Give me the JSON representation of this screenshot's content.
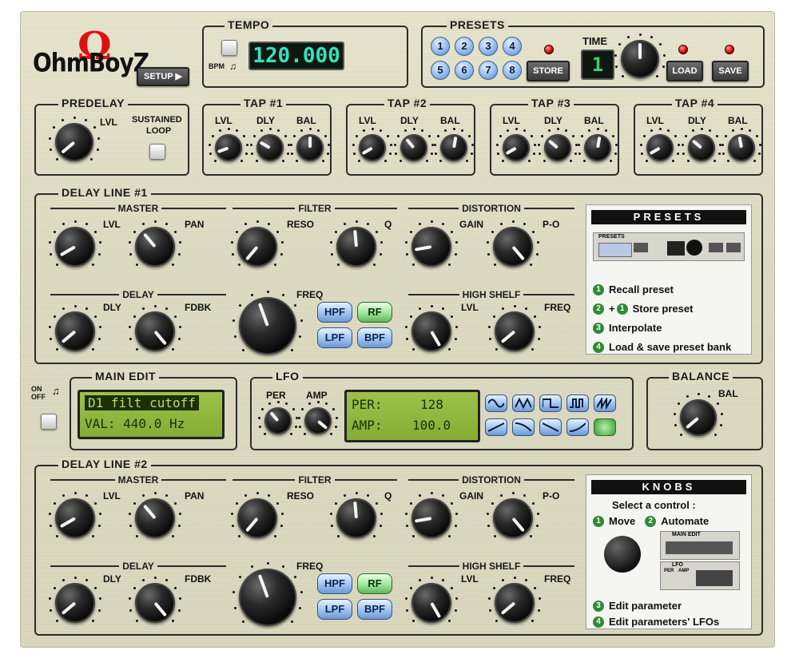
{
  "logo": {
    "text": "OhmBoyZ",
    "setup_label": "SETUP ▶"
  },
  "tempo": {
    "title": "TEMPO",
    "value": "120.000",
    "switch_label": "BPM"
  },
  "presets": {
    "title": "PRESETS",
    "buttons": [
      "1",
      "2",
      "3",
      "4",
      "5",
      "6",
      "7",
      "8"
    ],
    "store_label": "STORE",
    "time_label": "TIME",
    "time_value": "1",
    "load_label": "LOAD",
    "save_label": "SAVE"
  },
  "predelay": {
    "title": "PREDELAY",
    "lvl": "LVL",
    "sustained": "SUSTAINED",
    "loop": "LOOP"
  },
  "taps": [
    {
      "title": "TAP #1",
      "lvl": "LVL",
      "dly": "DLY",
      "bal": "BAL"
    },
    {
      "title": "TAP #2",
      "lvl": "LVL",
      "dly": "DLY",
      "bal": "BAL"
    },
    {
      "title": "TAP #3",
      "lvl": "LVL",
      "dly": "DLY",
      "bal": "BAL"
    },
    {
      "title": "TAP #4",
      "lvl": "LVL",
      "dly": "DLY",
      "bal": "BAL"
    }
  ],
  "delay_line_1": {
    "title": "DELAY LINE #1",
    "master": "MASTER",
    "filter": "FILTER",
    "distortion": "DISTORTION",
    "delay": "DELAY",
    "high_shelf": "HIGH SHELF",
    "lvl": "LVL",
    "pan": "PAN",
    "reso": "RESO",
    "q": "Q",
    "gain": "GAIN",
    "po": "P-O",
    "dly": "DLY",
    "fdbk": "FDBK",
    "freq": "FREQ",
    "hs_lvl": "LVL",
    "hs_freq": "FREQ",
    "hpf": "HPF",
    "rf": "RF",
    "lpf": "LPF",
    "bpf": "BPF"
  },
  "delay_line_2": {
    "title": "DELAY LINE #2",
    "master": "MASTER",
    "filter": "FILTER",
    "distortion": "DISTORTION",
    "delay": "DELAY",
    "high_shelf": "HIGH SHELF",
    "lvl": "LVL",
    "pan": "PAN",
    "reso": "RESO",
    "q": "Q",
    "gain": "GAIN",
    "po": "P-O",
    "dly": "DLY",
    "fdbk": "FDBK",
    "freq": "FREQ",
    "hs_lvl": "LVL",
    "hs_freq": "FREQ",
    "hpf": "HPF",
    "rf": "RF",
    "lpf": "LPF",
    "bpf": "BPF"
  },
  "presets_help": {
    "title": "PRESETS",
    "items": [
      {
        "num": "1",
        "text": "Recall preset"
      },
      {
        "num": "2",
        "num2": "1",
        "text": "Store preset"
      },
      {
        "num": "3",
        "text": "Interpolate"
      },
      {
        "num": "4",
        "text": "Load & save preset bank"
      }
    ],
    "mini_presets": "PRESETS"
  },
  "knobs_help": {
    "title": "KNOBS",
    "select": "Select a control :",
    "move_num": "1",
    "move": "Move",
    "automate_num": "2",
    "automate": "Automate",
    "mini_main_edit": "MAIN EDIT",
    "mini_lfo": "LFO",
    "mini_per": "PER",
    "mini_amp": "AMP",
    "items": [
      {
        "num": "3",
        "text": "Edit parameter"
      },
      {
        "num": "4",
        "text": "Edit parameters' LFOs"
      }
    ]
  },
  "onoff": {
    "on": "ON",
    "off": "OFF"
  },
  "main_edit": {
    "title": "MAIN EDIT",
    "line1": "D1 filt cutoff",
    "line2": "VAL: 440.0 Hz"
  },
  "lfo": {
    "title": "LFO",
    "per": "PER",
    "amp": "AMP",
    "lcd_per_label": "PER:",
    "lcd_per_value": "128",
    "lcd_amp_label": "AMP:",
    "lcd_amp_value": "100.0"
  },
  "balance": {
    "title": "BALANCE",
    "bal": "BAL"
  },
  "colors": {
    "panel": "#dedcc2",
    "lcd": "#8fb73d",
    "tempo_display": "#39e0c0",
    "filter_button": "#9fc3f0",
    "filter_active": "#9ee59a"
  }
}
